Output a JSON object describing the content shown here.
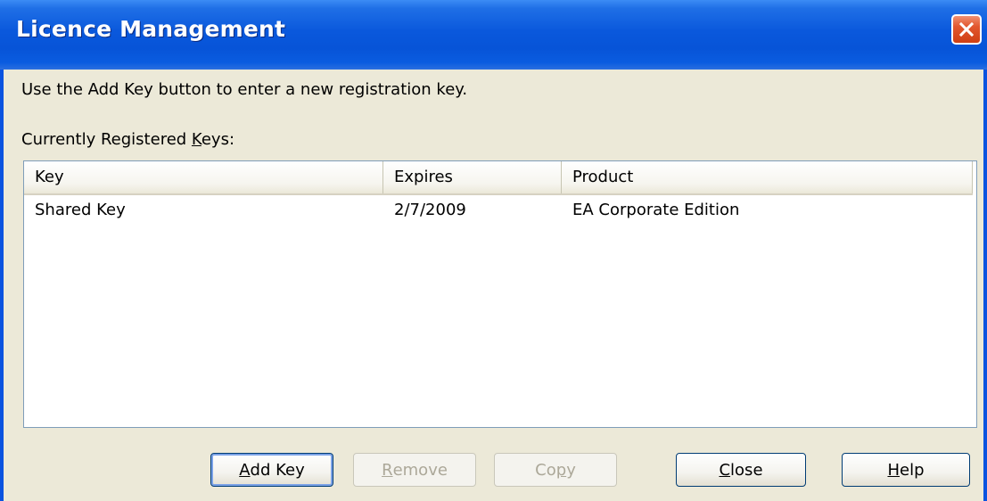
{
  "window": {
    "title": "Licence Management"
  },
  "instructions": "Use the Add Key button to enter a new registration key.",
  "registered_label": {
    "prefix": "Currently Registered ",
    "accel": "K",
    "suffix": "eys:"
  },
  "table": {
    "columns": [
      "Key",
      "Expires",
      "Product"
    ],
    "rows": [
      {
        "key": "Shared Key",
        "expires": "2/7/2009",
        "product": "EA Corporate Edition"
      }
    ]
  },
  "buttons": {
    "add_key": {
      "accel": "A",
      "rest": "dd Key",
      "enabled": true
    },
    "remove": {
      "accel": "R",
      "rest": "emove",
      "enabled": false
    },
    "copy": {
      "prefix": "Co",
      "accel": "p",
      "rest": "y",
      "enabled": false
    },
    "close": {
      "accel": "C",
      "rest": "lose",
      "enabled": true
    },
    "help": {
      "accel": "H",
      "rest": "elp",
      "enabled": true
    }
  },
  "icons": {
    "close": "close-icon"
  },
  "colors": {
    "titlebar": "#0a58dc",
    "dialog_bg": "#ece9d8",
    "close_button": "#e2562e"
  }
}
